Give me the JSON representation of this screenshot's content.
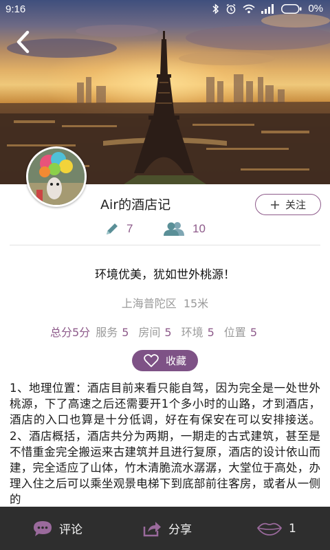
{
  "status_bar": {
    "time": "9:16",
    "battery_text": "0%",
    "icons": [
      "bluetooth-icon",
      "alarm-icon",
      "wifi-icon",
      "signal-icon",
      "battery-icon"
    ]
  },
  "hero": {
    "image_subject": "Eiffel Tower at sunset",
    "back_icon": "chevron-left-icon"
  },
  "profile": {
    "name": "Air的酒店记",
    "follow_label": "关注",
    "notes_count": "7",
    "fans_count": "10"
  },
  "post": {
    "title": "环境优美，犹如世外桃源！",
    "location": "上海普陀区",
    "distance": "15米",
    "rating_total": "总分5分",
    "ratings": [
      {
        "label": "服务",
        "value": "5"
      },
      {
        "label": "房间",
        "value": "5"
      },
      {
        "label": "环境",
        "value": "5"
      },
      {
        "label": "位置",
        "value": "5"
      }
    ],
    "collect_label": "收藏",
    "body": "1、地理位置：酒店目前来看只能自驾，因为完全是一处世外桃源，下了高速之后还需要开1个多小时的山路，才到酒店，酒店的入口也算是十分低调，好在有保安在可以安排接送。 2、酒店概括，酒店共分为两期，一期走的古式建筑，甚至是不惜重金完全搬运来古建筑并且进行复原，酒店的设计依山而建，完全适应了山体，竹木清脆流水潺潺，大堂位于高处，办理入住之后可以乘坐观景电梯下到底部前往客房，或者从一侧的"
  },
  "bottom_bar": {
    "comment_label": "评论",
    "share_label": "分享",
    "like_count": "1"
  },
  "colors": {
    "accent": "#8d5a8a",
    "collect_button": "#7e5286",
    "bottom_bar": "#2e2e2e",
    "stat_icon": "#5a8f97"
  }
}
